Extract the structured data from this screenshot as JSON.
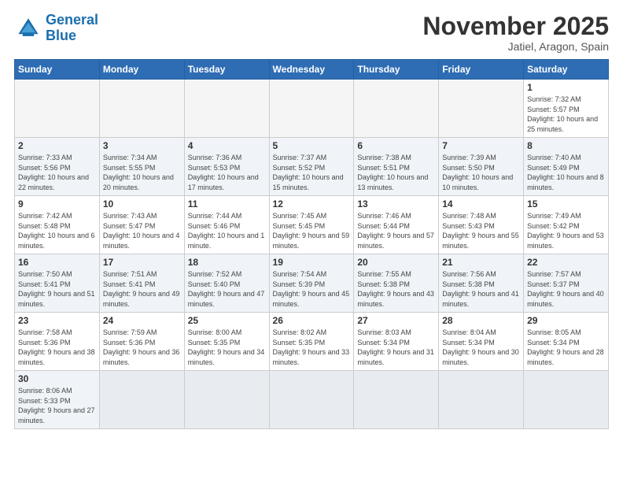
{
  "logo": {
    "text_general": "General",
    "text_blue": "Blue"
  },
  "header": {
    "month": "November 2025",
    "location": "Jatiel, Aragon, Spain"
  },
  "weekdays": [
    "Sunday",
    "Monday",
    "Tuesday",
    "Wednesday",
    "Thursday",
    "Friday",
    "Saturday"
  ],
  "weeks": [
    [
      {
        "day": "",
        "info": ""
      },
      {
        "day": "",
        "info": ""
      },
      {
        "day": "",
        "info": ""
      },
      {
        "day": "",
        "info": ""
      },
      {
        "day": "",
        "info": ""
      },
      {
        "day": "",
        "info": ""
      },
      {
        "day": "1",
        "info": "Sunrise: 7:32 AM\nSunset: 5:57 PM\nDaylight: 10 hours and 25 minutes."
      }
    ],
    [
      {
        "day": "2",
        "info": "Sunrise: 7:33 AM\nSunset: 5:56 PM\nDaylight: 10 hours and 22 minutes."
      },
      {
        "day": "3",
        "info": "Sunrise: 7:34 AM\nSunset: 5:55 PM\nDaylight: 10 hours and 20 minutes."
      },
      {
        "day": "4",
        "info": "Sunrise: 7:36 AM\nSunset: 5:53 PM\nDaylight: 10 hours and 17 minutes."
      },
      {
        "day": "5",
        "info": "Sunrise: 7:37 AM\nSunset: 5:52 PM\nDaylight: 10 hours and 15 minutes."
      },
      {
        "day": "6",
        "info": "Sunrise: 7:38 AM\nSunset: 5:51 PM\nDaylight: 10 hours and 13 minutes."
      },
      {
        "day": "7",
        "info": "Sunrise: 7:39 AM\nSunset: 5:50 PM\nDaylight: 10 hours and 10 minutes."
      },
      {
        "day": "8",
        "info": "Sunrise: 7:40 AM\nSunset: 5:49 PM\nDaylight: 10 hours and 8 minutes."
      }
    ],
    [
      {
        "day": "9",
        "info": "Sunrise: 7:42 AM\nSunset: 5:48 PM\nDaylight: 10 hours and 6 minutes."
      },
      {
        "day": "10",
        "info": "Sunrise: 7:43 AM\nSunset: 5:47 PM\nDaylight: 10 hours and 4 minutes."
      },
      {
        "day": "11",
        "info": "Sunrise: 7:44 AM\nSunset: 5:46 PM\nDaylight: 10 hours and 1 minute."
      },
      {
        "day": "12",
        "info": "Sunrise: 7:45 AM\nSunset: 5:45 PM\nDaylight: 9 hours and 59 minutes."
      },
      {
        "day": "13",
        "info": "Sunrise: 7:46 AM\nSunset: 5:44 PM\nDaylight: 9 hours and 57 minutes."
      },
      {
        "day": "14",
        "info": "Sunrise: 7:48 AM\nSunset: 5:43 PM\nDaylight: 9 hours and 55 minutes."
      },
      {
        "day": "15",
        "info": "Sunrise: 7:49 AM\nSunset: 5:42 PM\nDaylight: 9 hours and 53 minutes."
      }
    ],
    [
      {
        "day": "16",
        "info": "Sunrise: 7:50 AM\nSunset: 5:41 PM\nDaylight: 9 hours and 51 minutes."
      },
      {
        "day": "17",
        "info": "Sunrise: 7:51 AM\nSunset: 5:41 PM\nDaylight: 9 hours and 49 minutes."
      },
      {
        "day": "18",
        "info": "Sunrise: 7:52 AM\nSunset: 5:40 PM\nDaylight: 9 hours and 47 minutes."
      },
      {
        "day": "19",
        "info": "Sunrise: 7:54 AM\nSunset: 5:39 PM\nDaylight: 9 hours and 45 minutes."
      },
      {
        "day": "20",
        "info": "Sunrise: 7:55 AM\nSunset: 5:38 PM\nDaylight: 9 hours and 43 minutes."
      },
      {
        "day": "21",
        "info": "Sunrise: 7:56 AM\nSunset: 5:38 PM\nDaylight: 9 hours and 41 minutes."
      },
      {
        "day": "22",
        "info": "Sunrise: 7:57 AM\nSunset: 5:37 PM\nDaylight: 9 hours and 40 minutes."
      }
    ],
    [
      {
        "day": "23",
        "info": "Sunrise: 7:58 AM\nSunset: 5:36 PM\nDaylight: 9 hours and 38 minutes."
      },
      {
        "day": "24",
        "info": "Sunrise: 7:59 AM\nSunset: 5:36 PM\nDaylight: 9 hours and 36 minutes."
      },
      {
        "day": "25",
        "info": "Sunrise: 8:00 AM\nSunset: 5:35 PM\nDaylight: 9 hours and 34 minutes."
      },
      {
        "day": "26",
        "info": "Sunrise: 8:02 AM\nSunset: 5:35 PM\nDaylight: 9 hours and 33 minutes."
      },
      {
        "day": "27",
        "info": "Sunrise: 8:03 AM\nSunset: 5:34 PM\nDaylight: 9 hours and 31 minutes."
      },
      {
        "day": "28",
        "info": "Sunrise: 8:04 AM\nSunset: 5:34 PM\nDaylight: 9 hours and 30 minutes."
      },
      {
        "day": "29",
        "info": "Sunrise: 8:05 AM\nSunset: 5:34 PM\nDaylight: 9 hours and 28 minutes."
      }
    ],
    [
      {
        "day": "30",
        "info": "Sunrise: 8:06 AM\nSunset: 5:33 PM\nDaylight: 9 hours and 27 minutes."
      },
      {
        "day": "",
        "info": ""
      },
      {
        "day": "",
        "info": ""
      },
      {
        "day": "",
        "info": ""
      },
      {
        "day": "",
        "info": ""
      },
      {
        "day": "",
        "info": ""
      },
      {
        "day": "",
        "info": ""
      }
    ]
  ]
}
